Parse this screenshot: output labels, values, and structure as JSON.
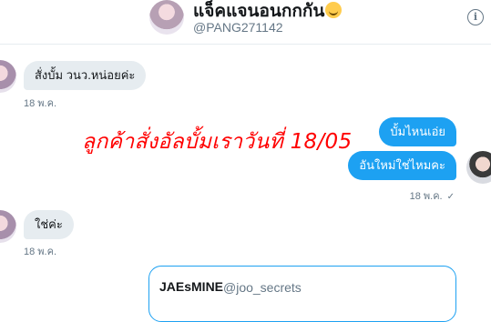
{
  "header": {
    "name": "แจ็คแจนอนกกกัน",
    "emoji": "smiling-face-icon",
    "handle": "@PANG271142",
    "info_icon": "info-icon",
    "info_glyph": "i"
  },
  "messages": [
    {
      "direction": "incoming",
      "text": "สั่งบั้ม วนว.หน่อยค่ะ",
      "time": "18 พ.ค."
    },
    {
      "direction": "outgoing",
      "text": "บั้มไหนเอ่ย",
      "time": ""
    },
    {
      "direction": "outgoing",
      "text": "อันใหม่ใช่ไหมคะ",
      "time": "18 พ.ค.",
      "status": "✓"
    },
    {
      "direction": "incoming",
      "text": "ใช่ค่ะ",
      "time": "18 พ.ค."
    }
  ],
  "annotation": "ลูกค้าสั่งอัลบั้มเราวันที่ 18/05",
  "quote": {
    "name": "JAEsMINE",
    "handle": "@joo_secrets"
  },
  "colors": {
    "accent": "#1da1f2",
    "incoming_bubble": "#e6ecf0",
    "annotation": "#ff0000"
  }
}
